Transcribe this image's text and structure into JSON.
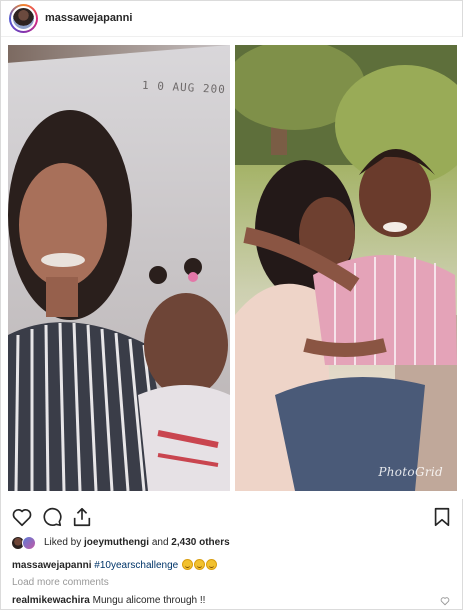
{
  "header": {
    "username": "massawejapanni",
    "avatar_icon": "user-avatar"
  },
  "post": {
    "date_stamp": "1 0 AUG 200",
    "watermark": "PhotoGrid"
  },
  "actions": {
    "like_icon": "heart-outline-icon",
    "comment_icon": "speech-bubble-icon",
    "share_icon": "share-upload-icon",
    "save_icon": "bookmark-icon"
  },
  "likes": {
    "prefix": "Liked by ",
    "user": "joeymuthengi",
    "middle": " and ",
    "others": "2,430 others"
  },
  "caption": {
    "username": "massawejapanni",
    "hashtag": "#10yearschallenge",
    "emoji_count": 3
  },
  "comments": {
    "load_more": "Load more comments",
    "items": [
      {
        "username": "realmikewachira",
        "text": "Mungu alicome through !!"
      }
    ]
  },
  "colors": {
    "text": "#262626",
    "muted": "#999999",
    "hashtag": "#003569",
    "border": "#dbdbdb"
  }
}
